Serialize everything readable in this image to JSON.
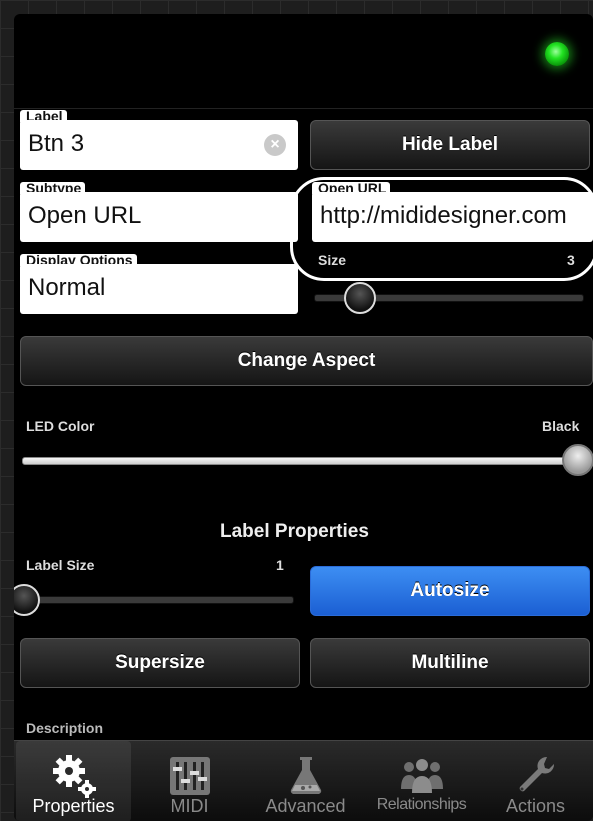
{
  "status": {
    "led_color": "#22e322"
  },
  "label_field": {
    "caption": "Label",
    "value": "Btn 3"
  },
  "hide_label_button": "Hide Label",
  "subtype_field": {
    "caption": "Subtype",
    "value": "Open URL"
  },
  "open_url_field": {
    "caption": "Open URL",
    "value": "http://midid­esigner.com"
  },
  "display_options_field": {
    "caption": "Display Options",
    "value": "Normal"
  },
  "size_slider": {
    "caption": "Size",
    "value": "3",
    "fraction": 0.17
  },
  "change_aspect_button": "Change Aspect",
  "led_color": {
    "caption": "LED Color",
    "value": "Black",
    "fraction": 1.0
  },
  "label_properties": {
    "title": "Label Properties",
    "label_size_caption": "Label Size",
    "label_size_value": "1",
    "label_size_fraction": 0.0,
    "autosize_button": "Autosize",
    "supersize_button": "Supersize",
    "multiline_button": "Multiline"
  },
  "partial_section": "Description",
  "tabs": [
    {
      "label": "Properties",
      "icon": "gear-icon",
      "active": true
    },
    {
      "label": "MIDI",
      "icon": "mixer-faders-icon",
      "active": false
    },
    {
      "label": "Advanced",
      "icon": "flask-icon",
      "active": false
    },
    {
      "label": "Relationships",
      "icon": "people-icon",
      "active": false
    },
    {
      "label": "Actions",
      "icon": "wrench-icon",
      "active": false
    }
  ],
  "colors": {
    "accent_blue": "#2f7ae8",
    "panel": "#000000"
  }
}
